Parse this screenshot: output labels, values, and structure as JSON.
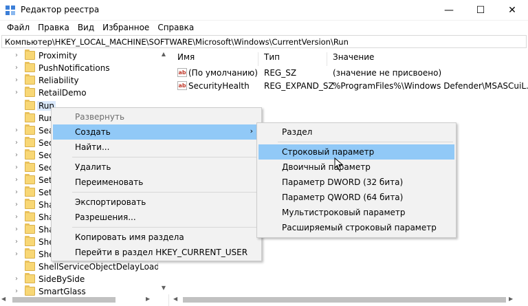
{
  "window": {
    "title": "Редактор реестра",
    "minimize_glyph": "—",
    "maximize_glyph": "☐",
    "close_glyph": "✕"
  },
  "menu": [
    "Файл",
    "Правка",
    "Вид",
    "Избранное",
    "Справка"
  ],
  "address": "Компьютер\\HKEY_LOCAL_MACHINE\\SOFTWARE\\Microsoft\\Windows\\CurrentVersion\\Run",
  "tree": {
    "items": [
      {
        "label": "Proximity"
      },
      {
        "label": "PushNotifications"
      },
      {
        "label": "Reliability"
      },
      {
        "label": "RetailDemo"
      },
      {
        "label": "Run",
        "selected": true
      },
      {
        "label": "Run"
      },
      {
        "label": "Sea"
      },
      {
        "label": "Sec"
      },
      {
        "label": "Sec"
      },
      {
        "label": "Sec"
      },
      {
        "label": "Set"
      },
      {
        "label": "Set"
      },
      {
        "label": "Sha"
      },
      {
        "label": "Sha"
      },
      {
        "label": "Sha"
      },
      {
        "label": "She"
      },
      {
        "label": "She"
      },
      {
        "label": "ShellServiceObjectDelayLoad"
      },
      {
        "label": "SideBySide"
      },
      {
        "label": "SmartGlass"
      }
    ]
  },
  "list": {
    "headers": {
      "name": "Имя",
      "type": "Тип",
      "value": "Значение"
    },
    "rows": [
      {
        "icon": "ab",
        "name": "(По умолчанию)",
        "type": "REG_SZ",
        "value": "(значение не присвоено)"
      },
      {
        "icon": "ab",
        "name": "SecurityHealth",
        "type": "REG_EXPAND_SZ",
        "value": "%ProgramFiles%\\Windows Defender\\MSASCuiL.exe"
      }
    ]
  },
  "context_menu": {
    "expand": "Развернуть",
    "create": "Создать",
    "find": "Найти...",
    "delete": "Удалить",
    "rename": "Переименовать",
    "export": "Экспортировать",
    "permissions": "Разрешения...",
    "copy_name": "Копировать имя раздела",
    "goto": "Перейти в раздел HKEY_CURRENT_USER",
    "submenu_arrow": "›"
  },
  "submenu": {
    "key": "Раздел",
    "string": "Строковый параметр",
    "binary": "Двоичный параметр",
    "dword": "Параметр DWORD (32 бита)",
    "qword": "Параметр QWORD (64 бита)",
    "multi": "Мультистроковый параметр",
    "expand": "Расширяемый строковый параметр"
  },
  "colors": {
    "hover": "#91c9f7",
    "selected": "#d9e8fb",
    "folder": "#f8d775"
  }
}
